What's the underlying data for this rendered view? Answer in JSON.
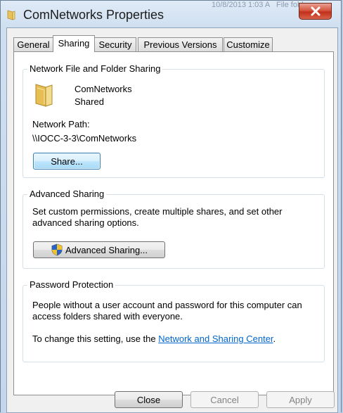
{
  "window": {
    "title": "ComNetworks Properties",
    "background_fragments": [
      "10/8/2013 1:03 A",
      "File folder"
    ]
  },
  "tabs": [
    {
      "label": "General",
      "active": false
    },
    {
      "label": "Sharing",
      "active": true
    },
    {
      "label": "Security",
      "active": false
    },
    {
      "label": "Previous Versions",
      "active": false
    },
    {
      "label": "Customize",
      "active": false
    }
  ],
  "network_sharing": {
    "heading": "Network File and Folder Sharing",
    "folder_name": "ComNetworks",
    "folder_status": "Shared",
    "path_label": "Network Path:",
    "path_value": "\\\\IOCC-3-3\\ComNetworks",
    "share_button": "Share..."
  },
  "advanced_sharing": {
    "heading": "Advanced Sharing",
    "description_line1": "Set custom permissions, create multiple shares, and set other",
    "description_line2": "advanced sharing options.",
    "button": "Advanced Sharing..."
  },
  "password_protection": {
    "heading": "Password Protection",
    "description_line1": "People without a user account and password for this computer can",
    "description_line2": "access folders shared with everyone.",
    "change_prefix": "To change this setting, use the ",
    "link_text": "Network and Sharing Center",
    "change_suffix": "."
  },
  "footer": {
    "close": "Close",
    "cancel": "Cancel",
    "apply": "Apply"
  },
  "colors": {
    "link": "#0066cc",
    "close_button_red": "#c2301a",
    "focus_blue": "#3c7fb1"
  },
  "icons": [
    "folder-icon",
    "close-x-icon",
    "uac-shield-icon"
  ]
}
